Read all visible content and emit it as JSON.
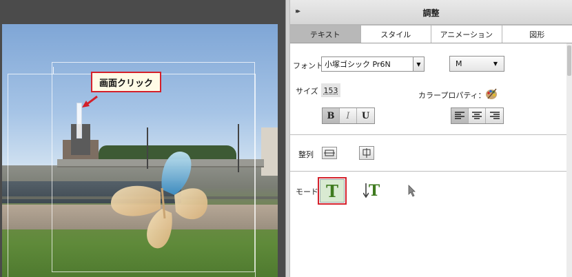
{
  "canvas": {
    "callout_text": "画面クリック"
  },
  "panel": {
    "title": "調整",
    "collapse_icon": "▸▸",
    "tabs": [
      {
        "label": "テキスト",
        "active": true
      },
      {
        "label": "スタイル",
        "active": false
      },
      {
        "label": "アニメーション",
        "active": false
      },
      {
        "label": "図形",
        "active": false
      }
    ],
    "font": {
      "label": "フォント",
      "family_value": "小塚ゴシック Pr6N",
      "style_value": "M"
    },
    "size": {
      "label": "サイズ",
      "value": "153"
    },
    "color_property_label": "カラープロパティ：",
    "style_buttons": {
      "bold": "B",
      "italic": "I",
      "underline": "U"
    },
    "align_buttons": [
      "align-left",
      "align-center",
      "align-right"
    ],
    "arrange_label": "整列",
    "mode": {
      "label": "モード",
      "horizontal_text": "T",
      "vertical_text": "T"
    },
    "accent_color": "#d4202a",
    "mode_icon_color": "#3f7a1f"
  }
}
